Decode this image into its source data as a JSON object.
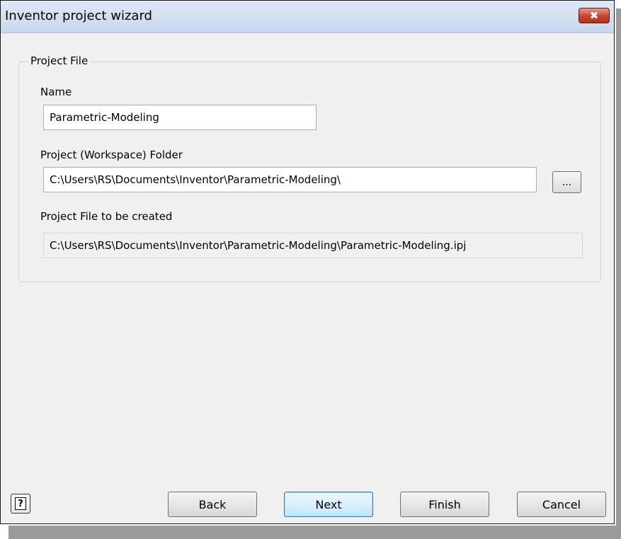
{
  "window": {
    "title": "Inventor project wizard",
    "close_glyph": "✖"
  },
  "group": {
    "legend": "Project File"
  },
  "name_field": {
    "label": "Name",
    "value": "Parametric-Modeling"
  },
  "folder_field": {
    "label": "Project (Workspace) Folder",
    "value": "C:\\Users\\RS\\Documents\\Inventor\\Parametric-Modeling\\",
    "browse_label": "..."
  },
  "created_field": {
    "label": "Project File to be created",
    "value": "C:\\Users\\RS\\Documents\\Inventor\\Parametric-Modeling\\Parametric-Modeling.ipj"
  },
  "footer": {
    "help_glyph": "?",
    "back_label": "Back",
    "next_label": "Next",
    "finish_label": "Finish",
    "cancel_label": "Cancel"
  },
  "colors": {
    "titlebar": "#c8d7ec",
    "close_button": "#c7452f",
    "dialog_bg": "#f0f0f0",
    "default_button_border": "#3c7fb1"
  }
}
